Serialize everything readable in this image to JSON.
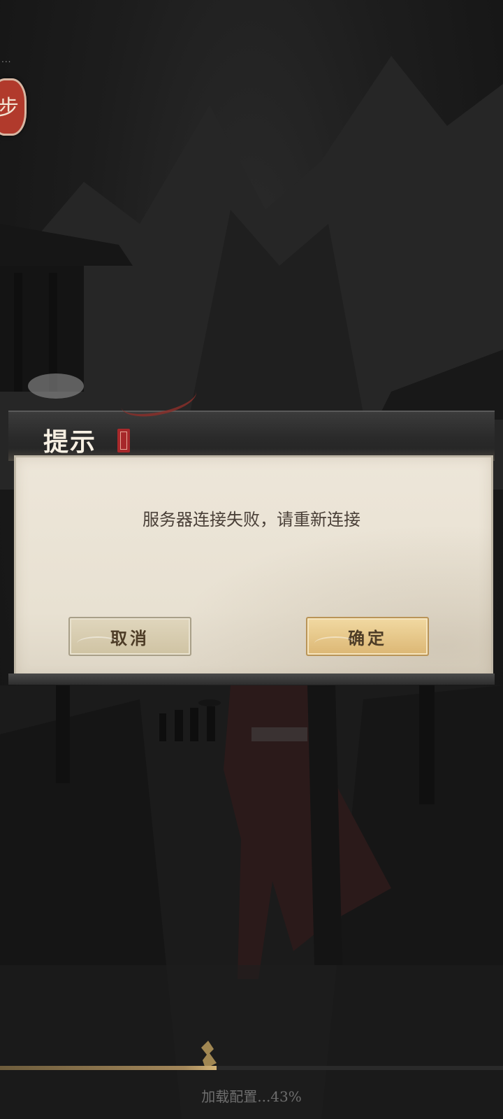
{
  "status_indicator": "...",
  "seal_char": "步",
  "dialog": {
    "title": "提示",
    "message": "服务器连接失败，请重新连接",
    "cancel_label": "取消",
    "confirm_label": "确定"
  },
  "loading": {
    "text": "加载配置...43%",
    "progress_percent": 43
  },
  "colors": {
    "dialog_body": "#ece5d8",
    "confirm_button": "#e6c98a",
    "cancel_button": "#d8ceb2",
    "seal_red": "#b13a2c"
  }
}
